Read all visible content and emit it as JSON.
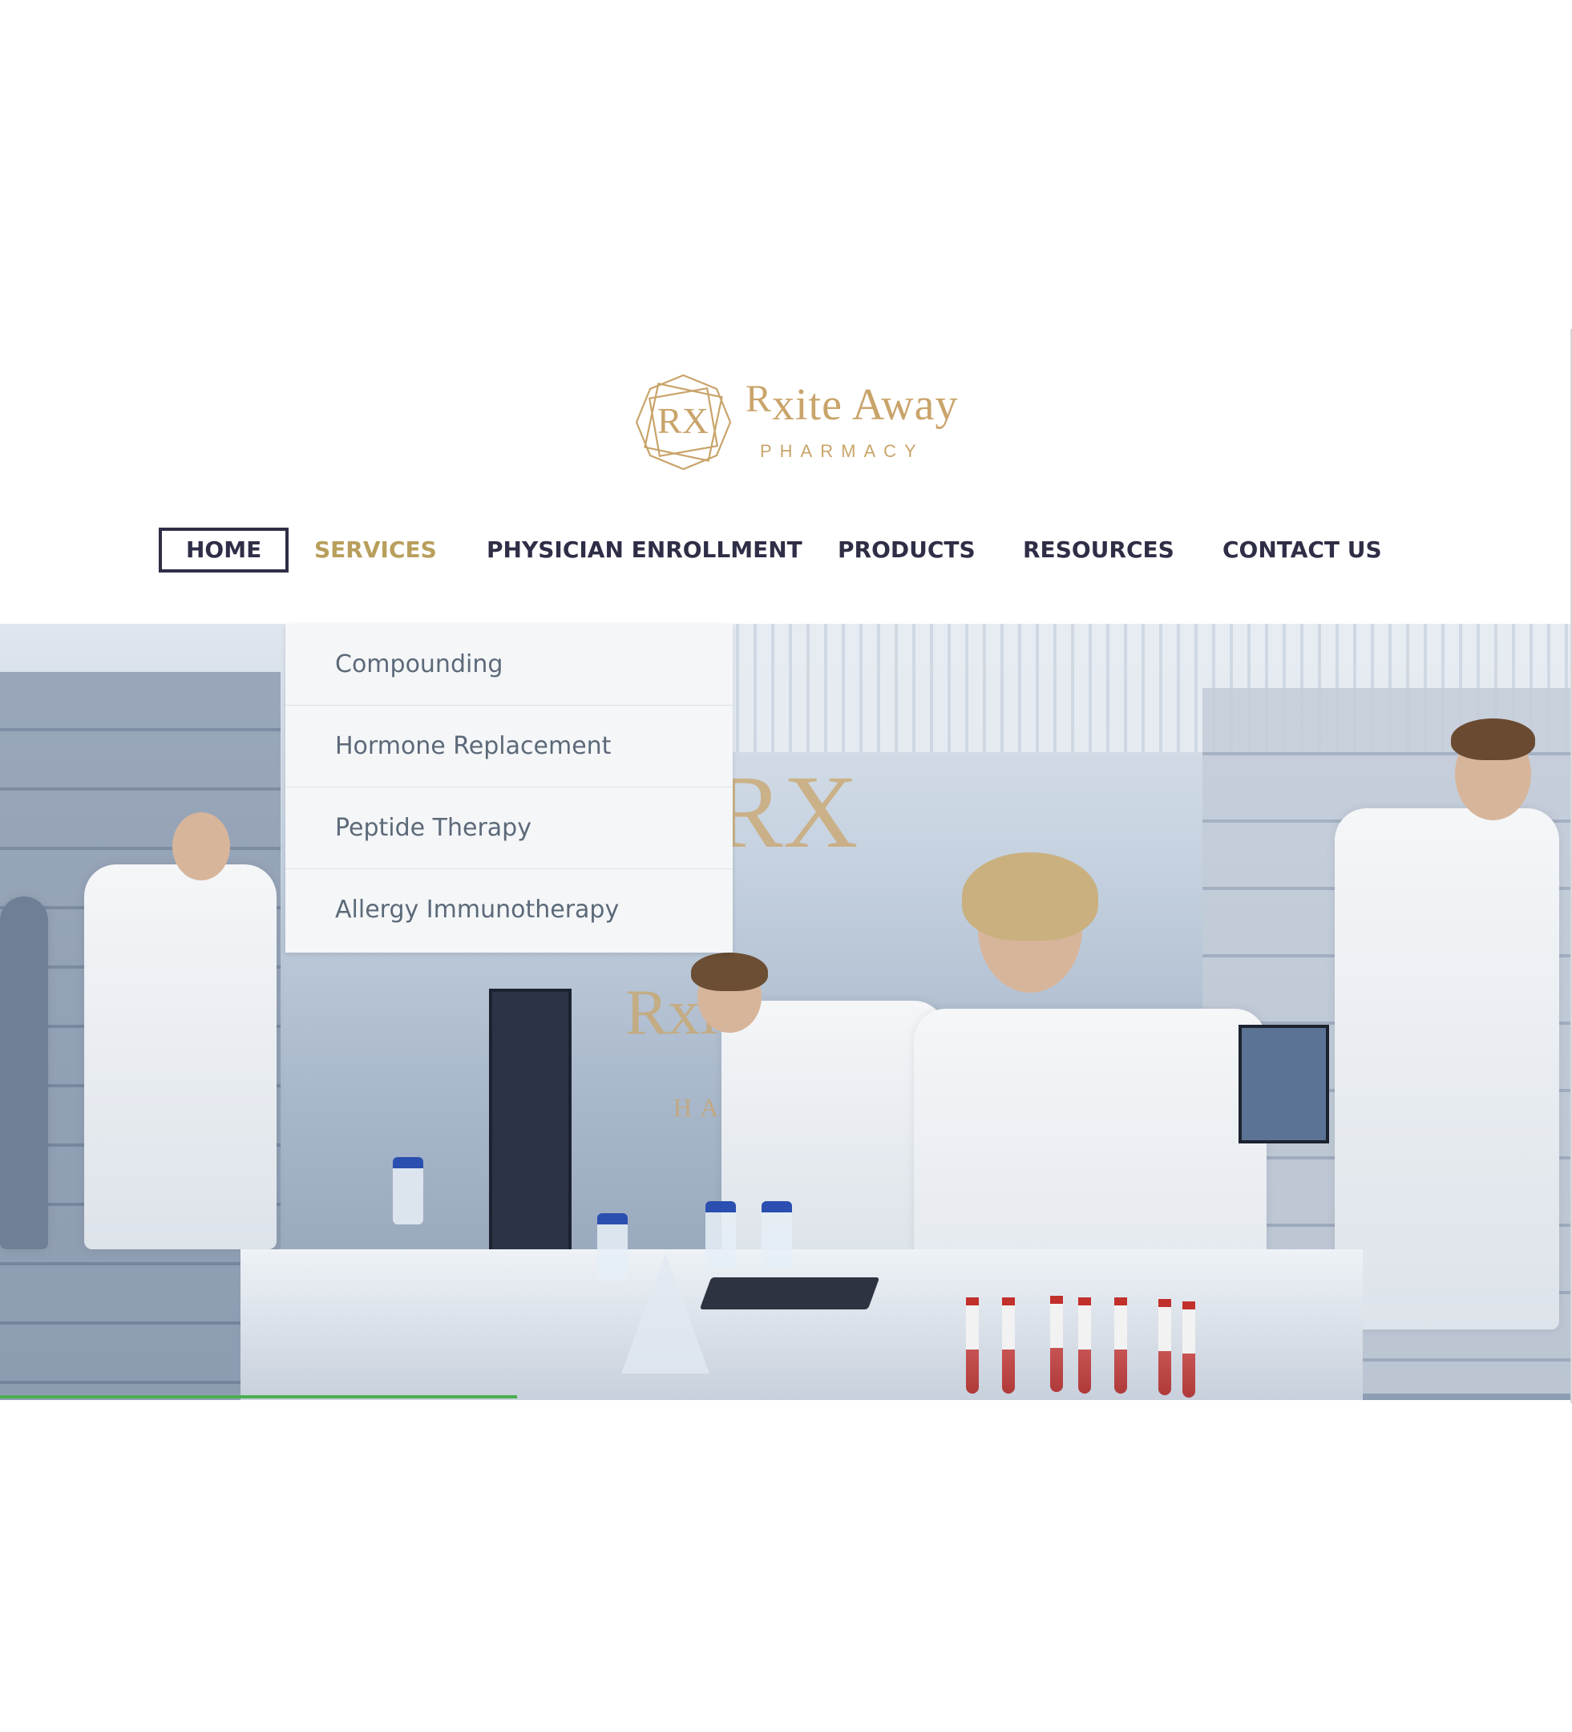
{
  "brand": {
    "name": "Rxite Away",
    "name_prefix": "R",
    "name_rest": "xite Away",
    "subtitle": "PHARMACY",
    "monogram": "RX",
    "color": "#c9a46a"
  },
  "nav": {
    "items": [
      {
        "label": "HOME",
        "active": true
      },
      {
        "label": "SERVICES",
        "hover": true
      },
      {
        "label": "PHYSICIAN ENROLLMENT"
      },
      {
        "label": "PRODUCTS"
      },
      {
        "label": "RESOURCES"
      },
      {
        "label": "CONTACT US"
      }
    ],
    "text_color": "#2f2e47",
    "hover_color": "#b89f5c"
  },
  "services_menu": {
    "items": [
      "Compounding",
      "Hormone Replacement",
      "Peptide Therapy",
      "Allergy Immunotherapy"
    ]
  },
  "hero": {
    "watermark_monogram": "RX",
    "watermark_name": "Rxi",
    "watermark_sub": "HARM",
    "progress_color": "#4caf50"
  }
}
